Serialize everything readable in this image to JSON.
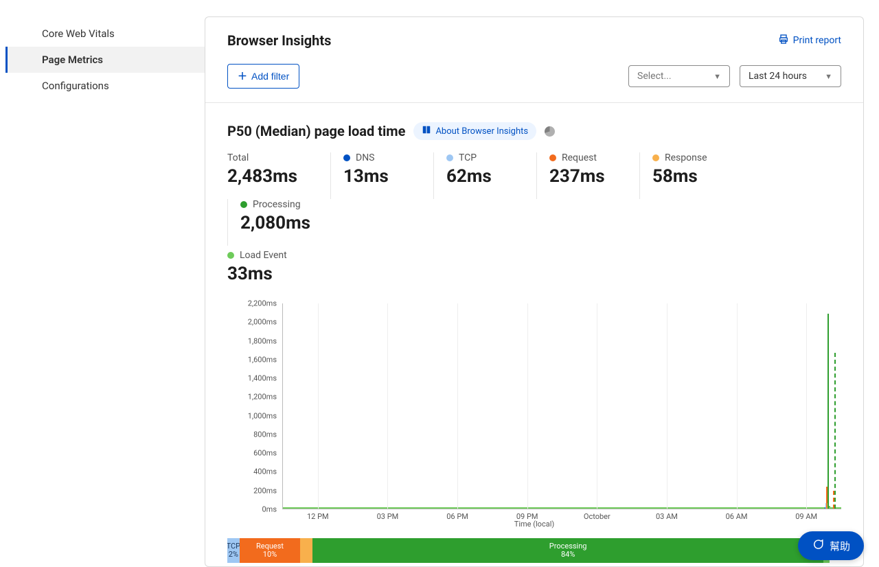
{
  "sidebar": {
    "items": [
      {
        "label": "Core Web Vitals",
        "active": false
      },
      {
        "label": "Page Metrics",
        "active": true
      },
      {
        "label": "Configurations",
        "active": false
      }
    ]
  },
  "header": {
    "title": "Browser Insights",
    "print_label": "Print report",
    "add_filter_label": "Add filter",
    "filter_select_placeholder": "Select...",
    "timerange_label": "Last 24 hours"
  },
  "section": {
    "title": "P50 (Median) page load time",
    "about_link": "About Browser Insights"
  },
  "metrics": [
    {
      "label": "Total",
      "value": "2,483ms",
      "color": null
    },
    {
      "label": "DNS",
      "value": "13ms",
      "color": "#0051c3"
    },
    {
      "label": "TCP",
      "value": "62ms",
      "color": "#9ec7f3"
    },
    {
      "label": "Request",
      "value": "237ms",
      "color": "#f26b1d"
    },
    {
      "label": "Response",
      "value": "58ms",
      "color": "#f8b04c"
    },
    {
      "label": "Processing",
      "value": "2,080ms",
      "color": "#2e9e2e"
    },
    {
      "label": "Load Event",
      "value": "33ms",
      "color": "#6ecb5a"
    }
  ],
  "stacked": [
    {
      "label": "TCP",
      "pct": "2%",
      "width": 2,
      "color": "#9ec7f3",
      "text": "#1d3a5f"
    },
    {
      "label": "Request",
      "pct": "10%",
      "width": 10,
      "color": "#f26b1d",
      "text": "#fff"
    },
    {
      "label": "",
      "pct": "",
      "width": 2,
      "color": "#f8b04c",
      "text": "#fff"
    },
    {
      "label": "Processing",
      "pct": "84%",
      "width": 84,
      "color": "#2e9e2e",
      "text": "#fff"
    },
    {
      "label": "",
      "pct": "",
      "width": 1,
      "color": "#6ecb5a",
      "text": "#fff"
    }
  ],
  "help": {
    "label": "幫助"
  },
  "chart_data": {
    "type": "line",
    "title": "P50 (Median) page load time",
    "xlabel": "Time (local)",
    "ylabel": "",
    "ylim": [
      0,
      2200
    ],
    "y_ticks": [
      "0ms",
      "200ms",
      "400ms",
      "600ms",
      "800ms",
      "1,000ms",
      "1,200ms",
      "1,400ms",
      "1,600ms",
      "1,800ms",
      "2,000ms",
      "2,200ms"
    ],
    "x_ticks": [
      "12 PM",
      "03 PM",
      "06 PM",
      "09 PM",
      "October",
      "03 AM",
      "06 AM",
      "09 AM"
    ],
    "series": [
      {
        "name": "DNS",
        "color": "#0051c3",
        "peak_ms": 13
      },
      {
        "name": "TCP",
        "color": "#9ec7f3",
        "peak_ms": 62
      },
      {
        "name": "Request",
        "color": "#f26b1d",
        "peak_ms": 237
      },
      {
        "name": "Response",
        "color": "#f8b04c",
        "peak_ms": 58
      },
      {
        "name": "Processing",
        "color": "#2e9e2e",
        "peak_ms": 2080
      },
      {
        "name": "Load Event",
        "color": "#6ecb5a",
        "peak_ms": 33
      }
    ],
    "note": "All series are ~0 across the time range and spike near the end (≈09:30 AM) to the listed peak_ms values."
  }
}
